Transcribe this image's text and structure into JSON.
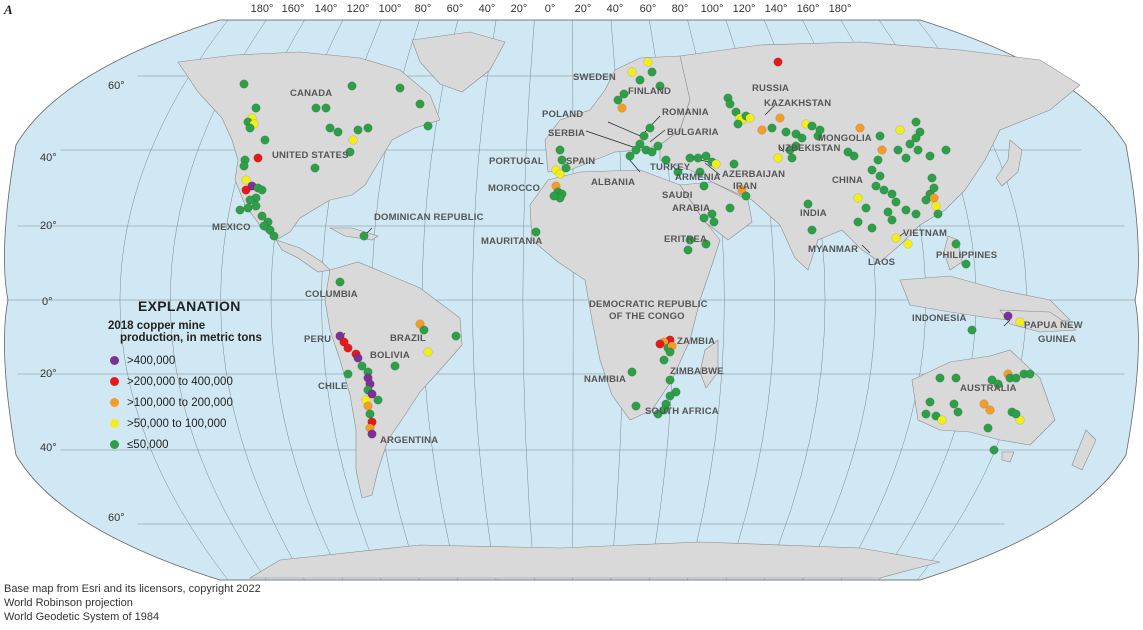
{
  "figure_letter": "A",
  "longitude_labels": [
    "180°",
    "160°",
    "140°",
    "120°",
    "100°",
    "80°",
    "60°",
    "40°",
    "20°",
    "0°",
    "20°",
    "40°",
    "60°",
    "80°",
    "100°",
    "120°",
    "140°",
    "160°",
    "180°"
  ],
  "latitude_labels": [
    "60°",
    "40°",
    "20°",
    "0°",
    "20°",
    "40°",
    "60°"
  ],
  "legend": {
    "title": "EXPLANATION",
    "subtitle_line1": "2018 copper mine",
    "subtitle_line2": "production, in metric tons",
    "classes": [
      {
        "label": ">400,000",
        "color": "#7b3294"
      },
      {
        "label": ">200,000 to 400,000",
        "color": "#e31a1c"
      },
      {
        "label": ">100,000 to 200,000",
        "color": "#f39c28"
      },
      {
        "label": ">50,000 to 100,000",
        "color": "#f2ee1c"
      },
      {
        "label": "≤50,000",
        "color": "#2e9e48"
      }
    ]
  },
  "countries": [
    "CANADA",
    "UNITED STATES",
    "MEXICO",
    "DOMINICAN REPUBLIC",
    "COLUMBIA",
    "PERU",
    "BRAZIL",
    "BOLIVIA",
    "CHILE",
    "ARGENTINA",
    "SWEDEN",
    "FINLAND",
    "POLAND",
    "ROMANIA",
    "SERBIA",
    "BULGARIA",
    "PORTUGAL",
    "SPAIN",
    "ALBANIA",
    "MOROCCO",
    "TURKEY",
    "ARMENIA",
    "AZERBAIJAN",
    "MAURITANIA",
    "SAUDI ARABIA",
    "ERITREA",
    "IRAN",
    "RUSSIA",
    "KAZAKHSTAN",
    "MONGOLIA",
    "UZBEKISTAN",
    "CHINA",
    "INDIA",
    "MYANMAR",
    "LAOS",
    "VIETNAM",
    "PHILIPPINES",
    "INDONESIA",
    "PAPUA NEW GUINEA",
    "AUSTRALIA",
    "DEMOCRATIC REPUBLIC OF THE CONGO",
    "ZAMBIA",
    "ZIMBABWE",
    "NAMIBIA",
    "SOUTH AFRICA"
  ],
  "source_lines": [
    "Base map from Esri and its licensors, copyright 2022",
    "World Robinson projection",
    "World Geodetic System of 1984"
  ],
  "colors": {
    "ocean": "#cfe8f3",
    "land": "#d9d9d9",
    "graticule": "#555555"
  }
}
